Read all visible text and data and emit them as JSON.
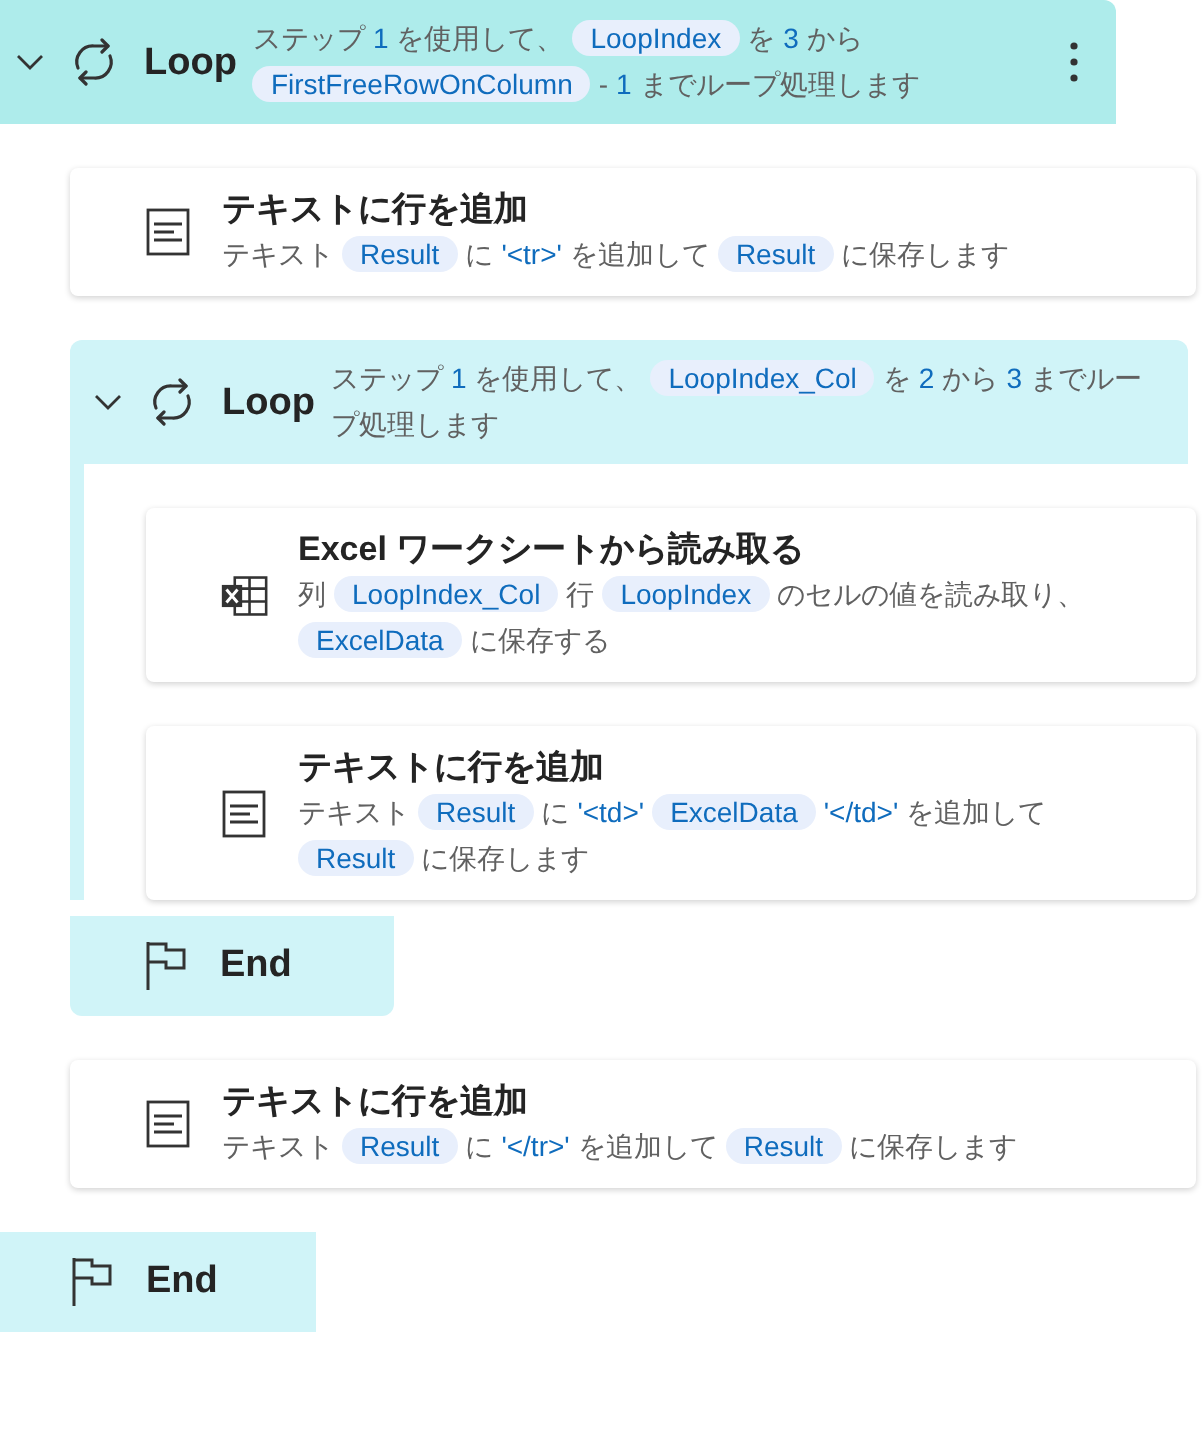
{
  "steps": [
    {
      "kind": "loop",
      "selected": true,
      "title": "Loop",
      "description": [
        {
          "text": "ステップ"
        },
        {
          "literal": "1"
        },
        {
          "text": "を使用して、"
        },
        {
          "variable": "LoopIndex"
        },
        {
          "text": "を"
        },
        {
          "literal": "3"
        },
        {
          "text": "から"
        },
        {
          "variable": "FirstFreeRowOnColumn"
        },
        {
          "text": "-"
        },
        {
          "literal": "1"
        },
        {
          "text": "までループ処理します"
        }
      ],
      "children": [
        {
          "kind": "text",
          "title": "テキストに行を追加",
          "description": [
            {
              "text": "テキスト"
            },
            {
              "variable": "Result"
            },
            {
              "text": "に"
            },
            {
              "literal": "'<tr>'"
            },
            {
              "text": "を追加して"
            },
            {
              "variable": "Result"
            },
            {
              "text": "に保存します"
            }
          ]
        },
        {
          "kind": "loop",
          "selected": false,
          "title": "Loop",
          "description": [
            {
              "text": "ステップ"
            },
            {
              "literal": "1"
            },
            {
              "text": "を使用して、"
            },
            {
              "variable": "LoopIndex_Col"
            },
            {
              "text": "を"
            },
            {
              "literal": "2"
            },
            {
              "text": "から"
            },
            {
              "literal": "3"
            },
            {
              "text": "までループ処理します"
            }
          ],
          "children": [
            {
              "kind": "excel",
              "title": "Excel ワークシートから読み取る",
              "description": [
                {
                  "text": "列"
                },
                {
                  "variable": "LoopIndex_Col"
                },
                {
                  "text": "行"
                },
                {
                  "variable": "LoopIndex"
                },
                {
                  "text": "のセルの値を読み取り、"
                },
                {
                  "variable": "ExcelData"
                },
                {
                  "text": "に保存する"
                }
              ]
            },
            {
              "kind": "text",
              "title": "テキストに行を追加",
              "description": [
                {
                  "text": "テキスト"
                },
                {
                  "variable": "Result"
                },
                {
                  "text": "に"
                },
                {
                  "literal": "'<td>'"
                },
                {
                  "variable": "ExcelData"
                },
                {
                  "literal": "'</td>'"
                },
                {
                  "text": "を追加して"
                },
                {
                  "variable": "Result"
                },
                {
                  "text": "に保存します"
                }
              ]
            },
            {
              "kind": "end",
              "title": "End"
            }
          ]
        },
        {
          "kind": "text",
          "title": "テキストに行を追加",
          "description": [
            {
              "text": "テキスト"
            },
            {
              "variable": "Result"
            },
            {
              "text": "に"
            },
            {
              "literal": "'</tr>'"
            },
            {
              "text": "を追加して"
            },
            {
              "variable": "Result"
            },
            {
              "text": "に保存します"
            }
          ]
        }
      ]
    },
    {
      "kind": "end",
      "title": "End"
    }
  ]
}
